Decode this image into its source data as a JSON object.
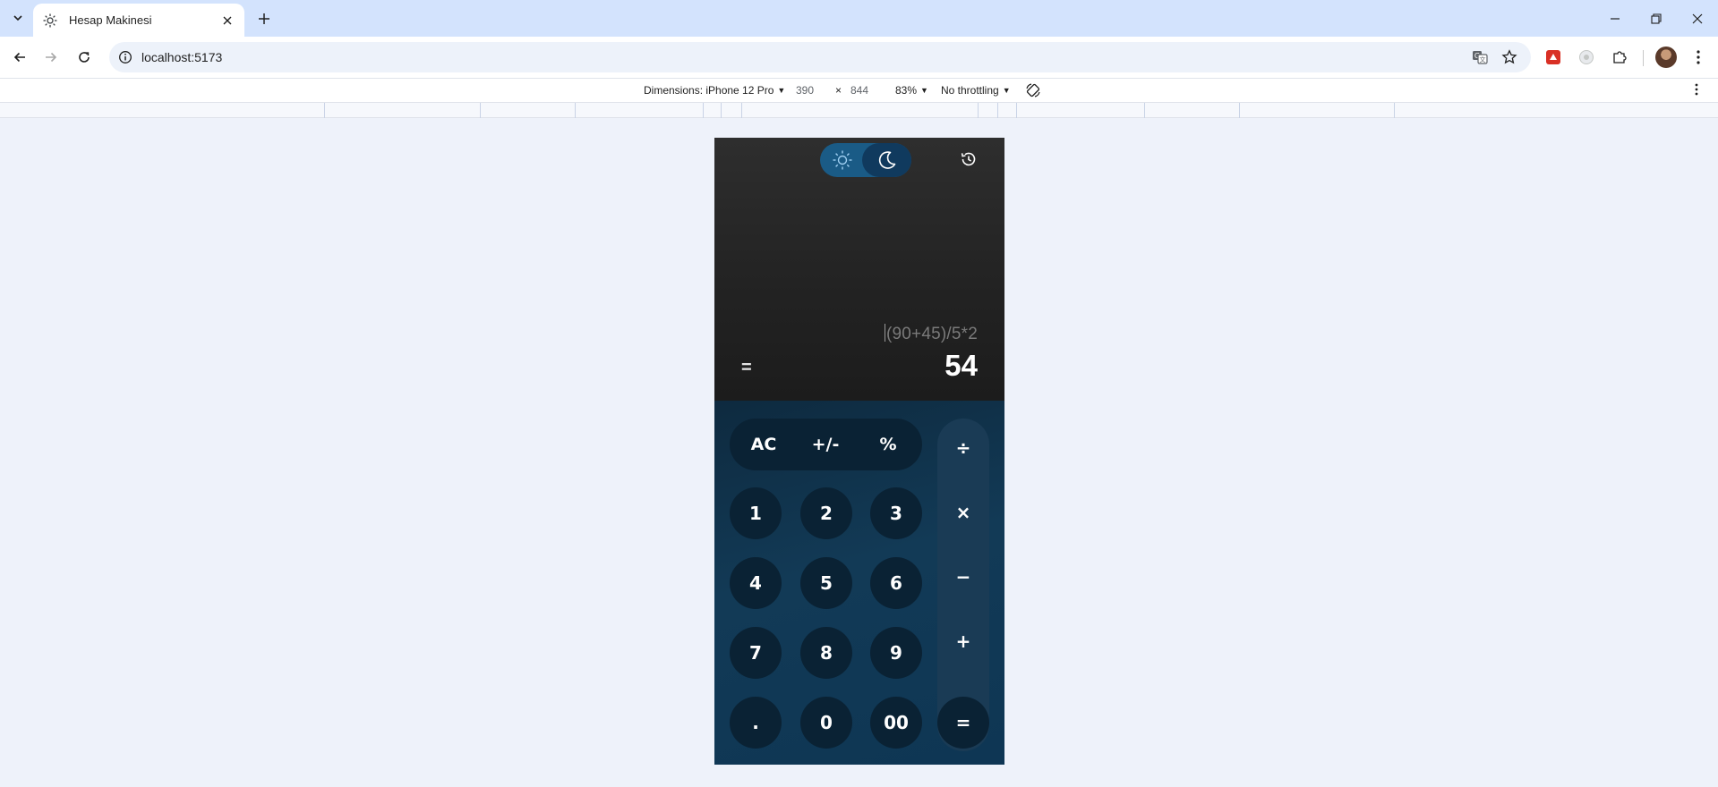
{
  "browser": {
    "tab": {
      "title": "Hesap Makinesi",
      "favicon": "sun-icon"
    },
    "url": "localhost:5173",
    "icons": [
      "back-icon",
      "forward-icon",
      "reload-icon",
      "site-info-icon",
      "translate-icon",
      "bookmark-star-icon",
      "extension-icon",
      "avatar"
    ]
  },
  "devtools": {
    "dimensions_label": "Dimensions: iPhone 12 Pro",
    "width": "390",
    "times": "×",
    "height": "844",
    "zoom": "83%",
    "throttling": "No throttling"
  },
  "calculator": {
    "theme": "dark",
    "expression": "(90+45)/5*2",
    "equals_label": "=",
    "result": "54",
    "function_keys": [
      "AC",
      "+/-",
      "%"
    ],
    "number_rows": [
      [
        "1",
        "2",
        "3"
      ],
      [
        "4",
        "5",
        "6"
      ],
      [
        "7",
        "8",
        "9"
      ],
      [
        ".",
        "0",
        "00"
      ]
    ],
    "operators": [
      "÷",
      "×",
      "−",
      "+",
      "="
    ],
    "colors": {
      "display_bg": "#232323",
      "keypad_bg": "#0f3048",
      "key_bg": "#0a2234",
      "toggle_light": "#1a5b86",
      "toggle_dark": "#103a5e"
    }
  }
}
